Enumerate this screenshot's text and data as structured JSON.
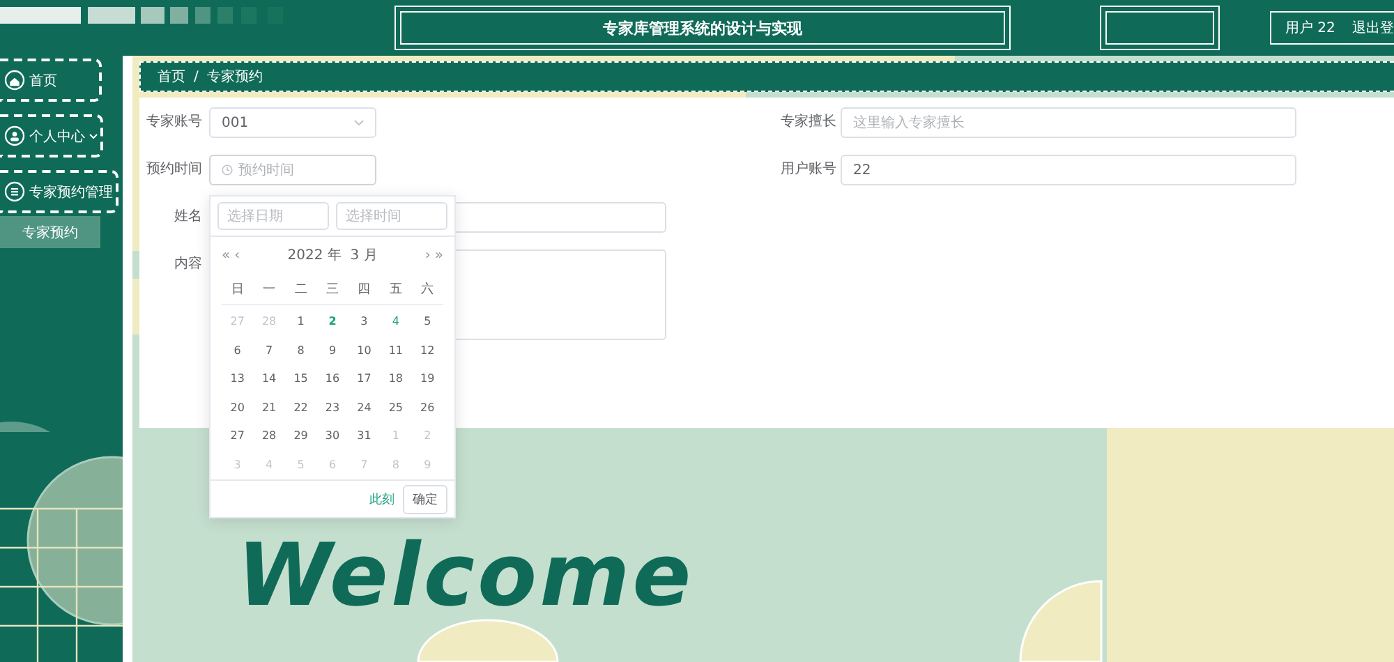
{
  "header": {
    "title": "专家库管理系统的设计与实现",
    "user": "用户 22",
    "logout": "退出登"
  },
  "sidebar": {
    "items": [
      {
        "label": "首页",
        "expandable": false
      },
      {
        "label": "个人中心",
        "expandable": true
      },
      {
        "label": "专家预约管理",
        "expandable": false,
        "children": [
          {
            "label": "专家预约",
            "selected": true
          }
        ]
      }
    ]
  },
  "breadcrumb": [
    "首页",
    "专家预约"
  ],
  "breadcrumb_separator": "/",
  "form": {
    "expert_account": {
      "label": "专家账号",
      "value": "001"
    },
    "time": {
      "label": "预约时间",
      "placeholder": "预约时间"
    },
    "name": {
      "label": "姓名"
    },
    "content": {
      "label": "内容"
    },
    "expertise": {
      "label": "专家擅长",
      "placeholder": "这里输入专家擅长"
    },
    "user_account": {
      "label": "用户账号",
      "value": "22"
    }
  },
  "date_picker": {
    "date_placeholder": "选择日期",
    "time_placeholder": "选择时间",
    "prev_year": "«",
    "prev_month": "‹",
    "next_month": "›",
    "next_year": "»",
    "title": "2022 年  3 月",
    "weekdays": [
      "日",
      "一",
      "二",
      "三",
      "四",
      "五",
      "六"
    ],
    "days": [
      {
        "label": "27",
        "kind": "other"
      },
      {
        "label": "28",
        "kind": "other"
      },
      {
        "label": "1",
        "kind": "current"
      },
      {
        "label": "2",
        "kind": "today"
      },
      {
        "label": "3",
        "kind": "current"
      },
      {
        "label": "4",
        "kind": "hover"
      },
      {
        "label": "5",
        "kind": "current"
      },
      {
        "label": "6",
        "kind": "current"
      },
      {
        "label": "7",
        "kind": "current"
      },
      {
        "label": "8",
        "kind": "current"
      },
      {
        "label": "9",
        "kind": "current"
      },
      {
        "label": "10",
        "kind": "current"
      },
      {
        "label": "11",
        "kind": "current"
      },
      {
        "label": "12",
        "kind": "current"
      },
      {
        "label": "13",
        "kind": "current"
      },
      {
        "label": "14",
        "kind": "current"
      },
      {
        "label": "15",
        "kind": "current"
      },
      {
        "label": "16",
        "kind": "current"
      },
      {
        "label": "17",
        "kind": "current"
      },
      {
        "label": "18",
        "kind": "current"
      },
      {
        "label": "19",
        "kind": "current"
      },
      {
        "label": "20",
        "kind": "current"
      },
      {
        "label": "21",
        "kind": "current"
      },
      {
        "label": "22",
        "kind": "current"
      },
      {
        "label": "23",
        "kind": "current"
      },
      {
        "label": "24",
        "kind": "current"
      },
      {
        "label": "25",
        "kind": "current"
      },
      {
        "label": "26",
        "kind": "current"
      },
      {
        "label": "27",
        "kind": "current"
      },
      {
        "label": "28",
        "kind": "current"
      },
      {
        "label": "29",
        "kind": "current"
      },
      {
        "label": "30",
        "kind": "current"
      },
      {
        "label": "31",
        "kind": "current"
      },
      {
        "label": "1",
        "kind": "other"
      },
      {
        "label": "2",
        "kind": "other"
      },
      {
        "label": "3",
        "kind": "other"
      },
      {
        "label": "4",
        "kind": "other"
      },
      {
        "label": "5",
        "kind": "other"
      },
      {
        "label": "6",
        "kind": "other"
      },
      {
        "label": "7",
        "kind": "other"
      },
      {
        "label": "8",
        "kind": "other"
      },
      {
        "label": "9",
        "kind": "other"
      }
    ],
    "now": "此刻",
    "confirm": "确定"
  },
  "welcome": "Welcome"
}
